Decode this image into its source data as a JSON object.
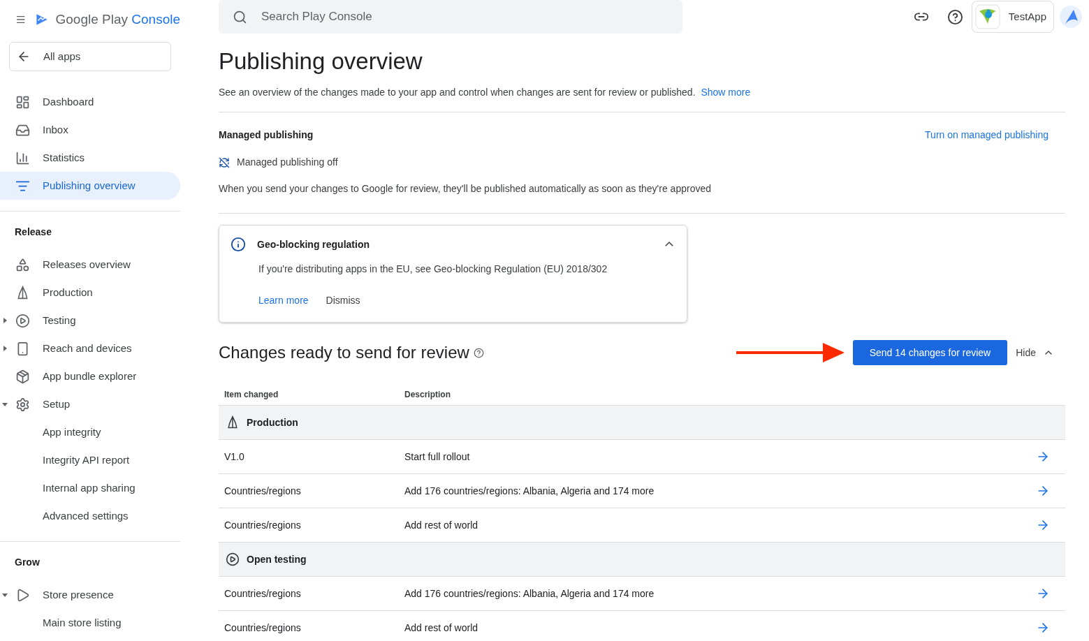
{
  "header": {
    "brand": "Google Play",
    "brand_accent": "Console",
    "search": {
      "placeholder": "Search Play Console"
    },
    "app_name": "TestApp"
  },
  "sidebar": {
    "back": "All apps",
    "top_items": [
      {
        "label": "Dashboard",
        "selected": false
      },
      {
        "label": "Inbox",
        "selected": false
      },
      {
        "label": "Statistics",
        "selected": false
      },
      {
        "label": "Publishing overview",
        "selected": true
      }
    ],
    "sections": [
      {
        "title": "Release",
        "items": [
          {
            "label": "Releases overview"
          },
          {
            "label": "Production"
          },
          {
            "label": "Testing",
            "expanded": false
          },
          {
            "label": "Reach and devices",
            "expanded": false
          },
          {
            "label": "App bundle explorer"
          },
          {
            "label": "Setup",
            "expanded": true,
            "children": [
              {
                "label": "App integrity"
              },
              {
                "label": "Integrity API report"
              },
              {
                "label": "Internal app sharing"
              },
              {
                "label": "Advanced settings"
              }
            ]
          }
        ]
      },
      {
        "title": "Grow",
        "items": [
          {
            "label": "Store presence",
            "expanded": true,
            "children": [
              {
                "label": "Main store listing"
              }
            ]
          }
        ]
      }
    ]
  },
  "page": {
    "title": "Publishing overview",
    "description": "See an overview of the changes made to your app and control when changes are sent for review or published.",
    "show_more": "Show more",
    "managed": {
      "heading": "Managed publishing",
      "action": "Turn on managed publishing",
      "status": "Managed publishing off",
      "note": "When you send your changes to Google for review, they'll be published automatically as soon as they're approved"
    },
    "notice": {
      "title": "Geo-blocking regulation",
      "body": "If you're distributing apps in the EU, see Geo-blocking Regulation (EU) 2018/302",
      "expanded": true,
      "actions": [
        "Learn more",
        "Dismiss"
      ]
    },
    "changes": {
      "title": "Changes ready to send for review",
      "send_button": "Send 14 changes for review",
      "hide": "Hide",
      "columns": [
        "Item changed",
        "Description"
      ],
      "groups": [
        {
          "name": "Production",
          "rows": [
            {
              "item": "V1.0",
              "description": "Start full rollout"
            },
            {
              "item": "Countries/regions",
              "description": "Add 176 countries/regions: Albania, Algeria and 174 more"
            },
            {
              "item": "Countries/regions",
              "description": "Add rest of world"
            }
          ]
        },
        {
          "name": "Open testing",
          "rows": [
            {
              "item": "Countries/regions",
              "description": "Add 176 countries/regions: Albania, Algeria and 174 more"
            },
            {
              "item": "Countries/regions",
              "description": "Add rest of world"
            }
          ]
        }
      ]
    }
  }
}
